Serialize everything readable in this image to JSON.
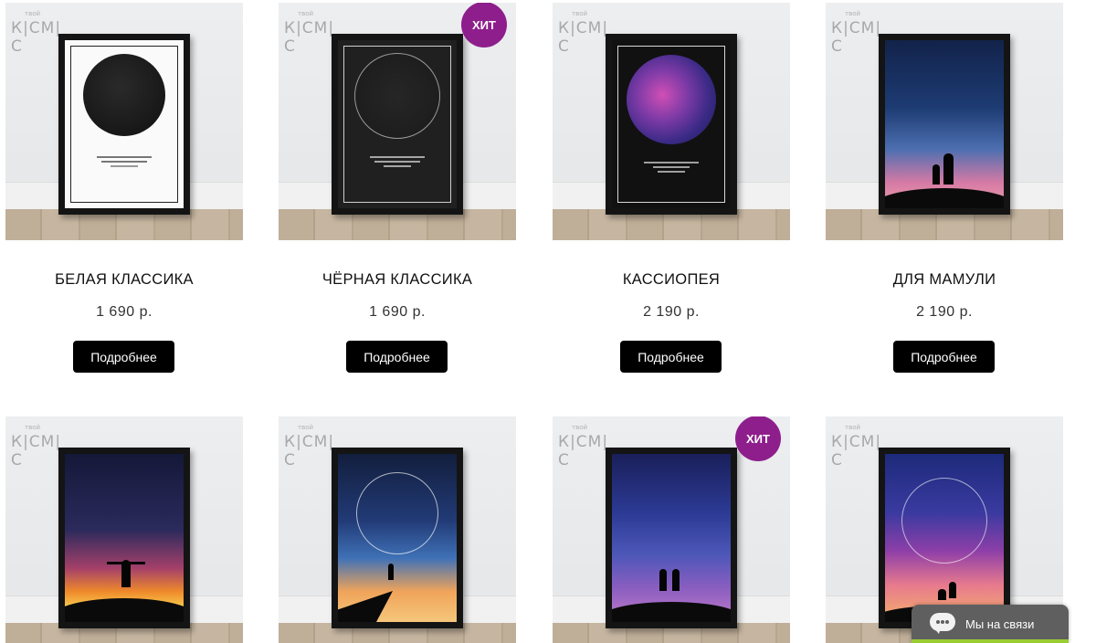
{
  "brand": {
    "logo_text": "К|СМ|С",
    "logo_small": "твой"
  },
  "products": [
    {
      "title": "БЕЛАЯ КЛАССИКА",
      "price": "1 690 р.",
      "button": "Подробнее",
      "badge": ""
    },
    {
      "title": "ЧЁРНАЯ КЛАССИКА",
      "price": "1 690 р.",
      "button": "Подробнее",
      "badge": "ХИТ"
    },
    {
      "title": "КАССИОПЕЯ",
      "price": "2 190 р.",
      "button": "Подробнее",
      "badge": ""
    },
    {
      "title": "ДЛЯ МАМУЛИ",
      "price": "2 190 р.",
      "button": "Подробнее",
      "badge": ""
    },
    {
      "title": "",
      "price": "",
      "button": "",
      "badge": ""
    },
    {
      "title": "",
      "price": "",
      "button": "",
      "badge": ""
    },
    {
      "title": "",
      "price": "",
      "button": "",
      "badge": "ХИТ"
    },
    {
      "title": "",
      "price": "",
      "button": "",
      "badge": ""
    }
  ],
  "chat_widget": {
    "label": "Мы на связи"
  },
  "colors": {
    "badge": "#8e1e8c",
    "button": "#000000",
    "chat_bg": "#5f5f5f",
    "chat_bar": "#9acd32"
  }
}
